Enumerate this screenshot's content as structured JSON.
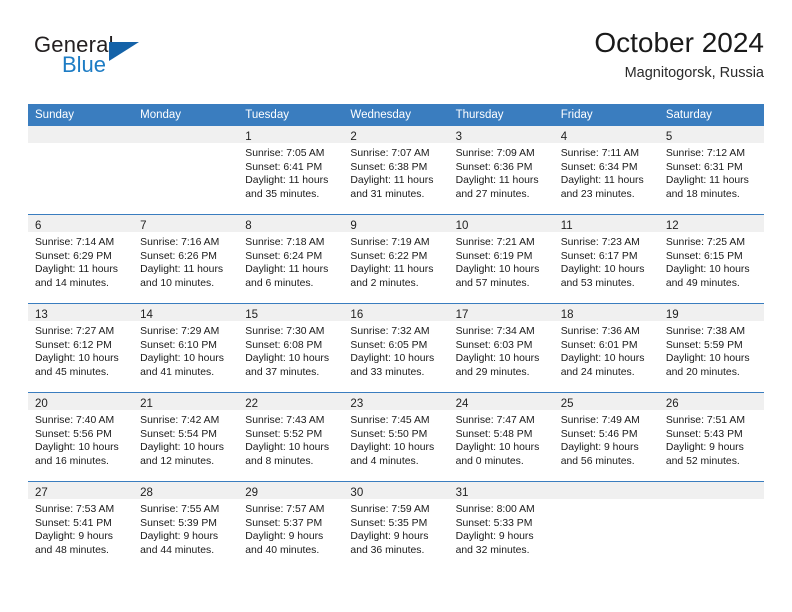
{
  "brand": {
    "name_part1": "General",
    "name_part2": "Blue",
    "triangle_color": "#1462a8",
    "blue_text_color": "#1d7cc4"
  },
  "header": {
    "month_title": "October 2024",
    "location": "Magnitogorsk, Russia"
  },
  "theme": {
    "header_blue": "#3a7dbf",
    "daynum_band": "#f0f0f0",
    "cell_background": "#ffffff",
    "text_color": "#1a1a1a"
  },
  "weekday_headers": [
    "Sunday",
    "Monday",
    "Tuesday",
    "Wednesday",
    "Thursday",
    "Friday",
    "Saturday"
  ],
  "weeks": [
    [
      {
        "day": "",
        "sunrise": "",
        "sunset": "",
        "daylight_line1": "",
        "daylight_line2": "",
        "empty": true
      },
      {
        "day": "",
        "sunrise": "",
        "sunset": "",
        "daylight_line1": "",
        "daylight_line2": "",
        "empty": true
      },
      {
        "day": "1",
        "sunrise": "Sunrise: 7:05 AM",
        "sunset": "Sunset: 6:41 PM",
        "daylight_line1": "Daylight: 11 hours",
        "daylight_line2": "and 35 minutes.",
        "empty": false
      },
      {
        "day": "2",
        "sunrise": "Sunrise: 7:07 AM",
        "sunset": "Sunset: 6:38 PM",
        "daylight_line1": "Daylight: 11 hours",
        "daylight_line2": "and 31 minutes.",
        "empty": false
      },
      {
        "day": "3",
        "sunrise": "Sunrise: 7:09 AM",
        "sunset": "Sunset: 6:36 PM",
        "daylight_line1": "Daylight: 11 hours",
        "daylight_line2": "and 27 minutes.",
        "empty": false
      },
      {
        "day": "4",
        "sunrise": "Sunrise: 7:11 AM",
        "sunset": "Sunset: 6:34 PM",
        "daylight_line1": "Daylight: 11 hours",
        "daylight_line2": "and 23 minutes.",
        "empty": false
      },
      {
        "day": "5",
        "sunrise": "Sunrise: 7:12 AM",
        "sunset": "Sunset: 6:31 PM",
        "daylight_line1": "Daylight: 11 hours",
        "daylight_line2": "and 18 minutes.",
        "empty": false
      }
    ],
    [
      {
        "day": "6",
        "sunrise": "Sunrise: 7:14 AM",
        "sunset": "Sunset: 6:29 PM",
        "daylight_line1": "Daylight: 11 hours",
        "daylight_line2": "and 14 minutes.",
        "empty": false
      },
      {
        "day": "7",
        "sunrise": "Sunrise: 7:16 AM",
        "sunset": "Sunset: 6:26 PM",
        "daylight_line1": "Daylight: 11 hours",
        "daylight_line2": "and 10 minutes.",
        "empty": false
      },
      {
        "day": "8",
        "sunrise": "Sunrise: 7:18 AM",
        "sunset": "Sunset: 6:24 PM",
        "daylight_line1": "Daylight: 11 hours",
        "daylight_line2": "and 6 minutes.",
        "empty": false
      },
      {
        "day": "9",
        "sunrise": "Sunrise: 7:19 AM",
        "sunset": "Sunset: 6:22 PM",
        "daylight_line1": "Daylight: 11 hours",
        "daylight_line2": "and 2 minutes.",
        "empty": false
      },
      {
        "day": "10",
        "sunrise": "Sunrise: 7:21 AM",
        "sunset": "Sunset: 6:19 PM",
        "daylight_line1": "Daylight: 10 hours",
        "daylight_line2": "and 57 minutes.",
        "empty": false
      },
      {
        "day": "11",
        "sunrise": "Sunrise: 7:23 AM",
        "sunset": "Sunset: 6:17 PM",
        "daylight_line1": "Daylight: 10 hours",
        "daylight_line2": "and 53 minutes.",
        "empty": false
      },
      {
        "day": "12",
        "sunrise": "Sunrise: 7:25 AM",
        "sunset": "Sunset: 6:15 PM",
        "daylight_line1": "Daylight: 10 hours",
        "daylight_line2": "and 49 minutes.",
        "empty": false
      }
    ],
    [
      {
        "day": "13",
        "sunrise": "Sunrise: 7:27 AM",
        "sunset": "Sunset: 6:12 PM",
        "daylight_line1": "Daylight: 10 hours",
        "daylight_line2": "and 45 minutes.",
        "empty": false
      },
      {
        "day": "14",
        "sunrise": "Sunrise: 7:29 AM",
        "sunset": "Sunset: 6:10 PM",
        "daylight_line1": "Daylight: 10 hours",
        "daylight_line2": "and 41 minutes.",
        "empty": false
      },
      {
        "day": "15",
        "sunrise": "Sunrise: 7:30 AM",
        "sunset": "Sunset: 6:08 PM",
        "daylight_line1": "Daylight: 10 hours",
        "daylight_line2": "and 37 minutes.",
        "empty": false
      },
      {
        "day": "16",
        "sunrise": "Sunrise: 7:32 AM",
        "sunset": "Sunset: 6:05 PM",
        "daylight_line1": "Daylight: 10 hours",
        "daylight_line2": "and 33 minutes.",
        "empty": false
      },
      {
        "day": "17",
        "sunrise": "Sunrise: 7:34 AM",
        "sunset": "Sunset: 6:03 PM",
        "daylight_line1": "Daylight: 10 hours",
        "daylight_line2": "and 29 minutes.",
        "empty": false
      },
      {
        "day": "18",
        "sunrise": "Sunrise: 7:36 AM",
        "sunset": "Sunset: 6:01 PM",
        "daylight_line1": "Daylight: 10 hours",
        "daylight_line2": "and 24 minutes.",
        "empty": false
      },
      {
        "day": "19",
        "sunrise": "Sunrise: 7:38 AM",
        "sunset": "Sunset: 5:59 PM",
        "daylight_line1": "Daylight: 10 hours",
        "daylight_line2": "and 20 minutes.",
        "empty": false
      }
    ],
    [
      {
        "day": "20",
        "sunrise": "Sunrise: 7:40 AM",
        "sunset": "Sunset: 5:56 PM",
        "daylight_line1": "Daylight: 10 hours",
        "daylight_line2": "and 16 minutes.",
        "empty": false
      },
      {
        "day": "21",
        "sunrise": "Sunrise: 7:42 AM",
        "sunset": "Sunset: 5:54 PM",
        "daylight_line1": "Daylight: 10 hours",
        "daylight_line2": "and 12 minutes.",
        "empty": false
      },
      {
        "day": "22",
        "sunrise": "Sunrise: 7:43 AM",
        "sunset": "Sunset: 5:52 PM",
        "daylight_line1": "Daylight: 10 hours",
        "daylight_line2": "and 8 minutes.",
        "empty": false
      },
      {
        "day": "23",
        "sunrise": "Sunrise: 7:45 AM",
        "sunset": "Sunset: 5:50 PM",
        "daylight_line1": "Daylight: 10 hours",
        "daylight_line2": "and 4 minutes.",
        "empty": false
      },
      {
        "day": "24",
        "sunrise": "Sunrise: 7:47 AM",
        "sunset": "Sunset: 5:48 PM",
        "daylight_line1": "Daylight: 10 hours",
        "daylight_line2": "and 0 minutes.",
        "empty": false
      },
      {
        "day": "25",
        "sunrise": "Sunrise: 7:49 AM",
        "sunset": "Sunset: 5:46 PM",
        "daylight_line1": "Daylight: 9 hours",
        "daylight_line2": "and 56 minutes.",
        "empty": false
      },
      {
        "day": "26",
        "sunrise": "Sunrise: 7:51 AM",
        "sunset": "Sunset: 5:43 PM",
        "daylight_line1": "Daylight: 9 hours",
        "daylight_line2": "and 52 minutes.",
        "empty": false
      }
    ],
    [
      {
        "day": "27",
        "sunrise": "Sunrise: 7:53 AM",
        "sunset": "Sunset: 5:41 PM",
        "daylight_line1": "Daylight: 9 hours",
        "daylight_line2": "and 48 minutes.",
        "empty": false
      },
      {
        "day": "28",
        "sunrise": "Sunrise: 7:55 AM",
        "sunset": "Sunset: 5:39 PM",
        "daylight_line1": "Daylight: 9 hours",
        "daylight_line2": "and 44 minutes.",
        "empty": false
      },
      {
        "day": "29",
        "sunrise": "Sunrise: 7:57 AM",
        "sunset": "Sunset: 5:37 PM",
        "daylight_line1": "Daylight: 9 hours",
        "daylight_line2": "and 40 minutes.",
        "empty": false
      },
      {
        "day": "30",
        "sunrise": "Sunrise: 7:59 AM",
        "sunset": "Sunset: 5:35 PM",
        "daylight_line1": "Daylight: 9 hours",
        "daylight_line2": "and 36 minutes.",
        "empty": false
      },
      {
        "day": "31",
        "sunrise": "Sunrise: 8:00 AM",
        "sunset": "Sunset: 5:33 PM",
        "daylight_line1": "Daylight: 9 hours",
        "daylight_line2": "and 32 minutes.",
        "empty": false
      },
      {
        "day": "",
        "sunrise": "",
        "sunset": "",
        "daylight_line1": "",
        "daylight_line2": "",
        "empty": true
      },
      {
        "day": "",
        "sunrise": "",
        "sunset": "",
        "daylight_line1": "",
        "daylight_line2": "",
        "empty": true
      }
    ]
  ]
}
